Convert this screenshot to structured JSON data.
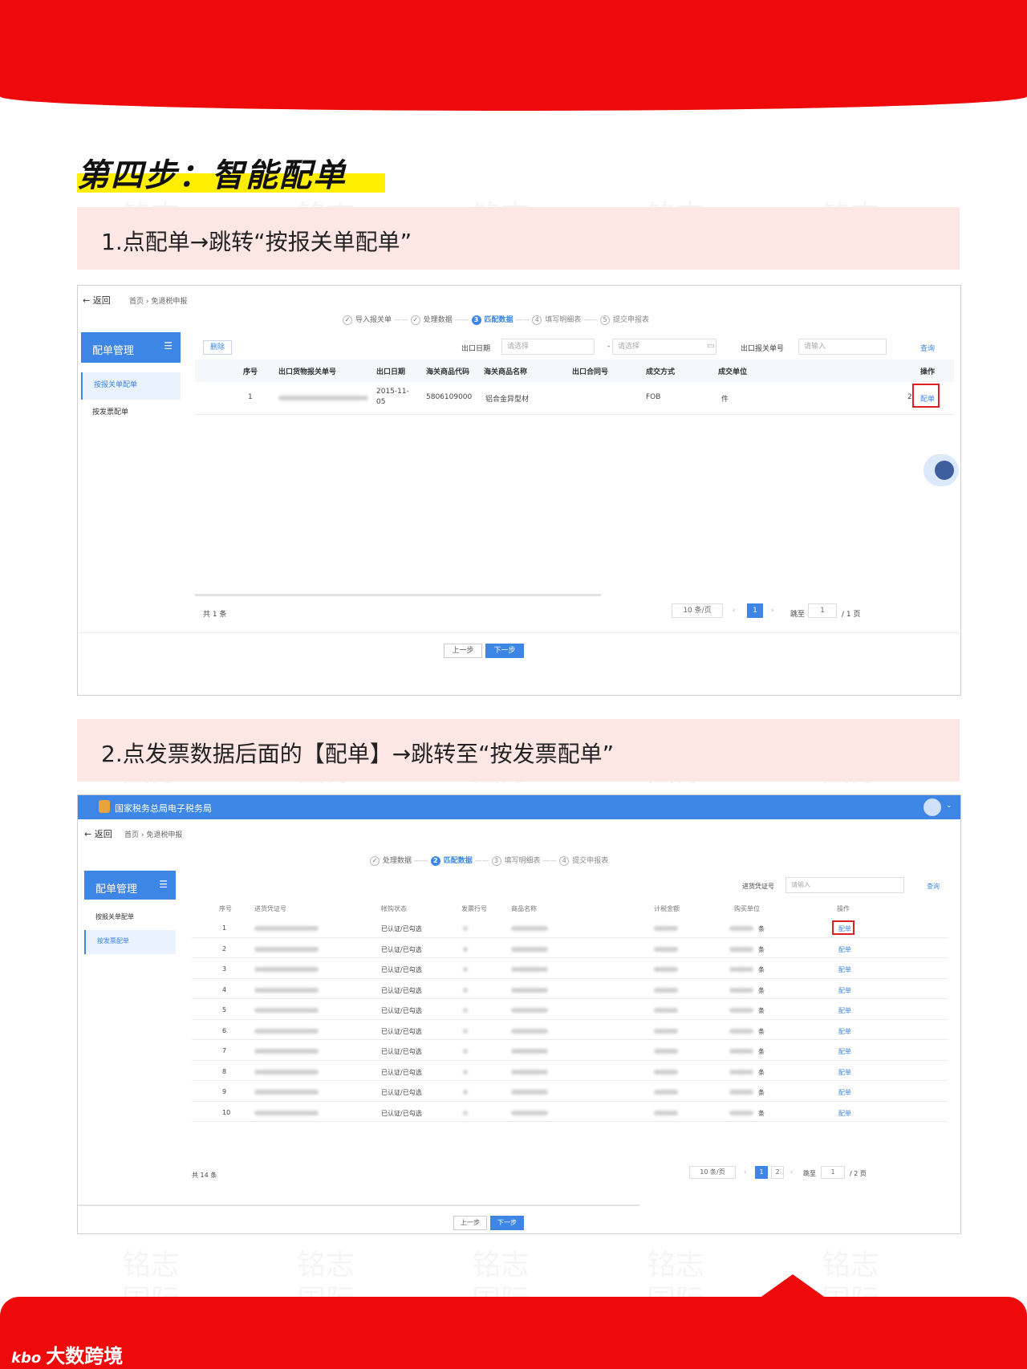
{
  "page": {
    "step_title": "第四步：智能配单",
    "instruction_1": "1.点配单→跳转“按报关单配单”",
    "instruction_2": "2.点发票数据后面的【配单】→跳转至“按发票配单”",
    "watermark_line1": "铭志",
    "watermark_line2": "国际",
    "brand": "大数跨境",
    "brand_logo": "kbo"
  },
  "colors": {
    "brand_red": "#ee0a0a",
    "accent_blue": "#3d86e6",
    "highlight_yellow": "#ffee00",
    "pink_bar": "#fde7e5",
    "annotation_red": "#e02020"
  },
  "screen1": {
    "back_label": "← 返回",
    "breadcrumb": "首页 › 免退税申报",
    "steps": [
      {
        "num": "✓",
        "label": "导入报关单",
        "state": "done"
      },
      {
        "num": "✓",
        "label": "处理数据",
        "state": "done"
      },
      {
        "num": "3",
        "label": "匹配数据",
        "state": "current"
      },
      {
        "num": "4",
        "label": "填写明细表",
        "state": "todo"
      },
      {
        "num": "5",
        "label": "提交申报表",
        "state": "todo"
      }
    ],
    "sidebar": {
      "title": "配单管理",
      "menu_icon": "☰",
      "items": [
        "按报关单配单",
        "按发票配单"
      ],
      "active_index": 0
    },
    "toolbar": {
      "delete_label": "删除",
      "date_label": "出口日期",
      "date_placeholder_start": "请选择",
      "date_separator": "-",
      "date_placeholder_end": "请选择",
      "calendar_icon": "calendar-icon",
      "declaration_label": "出口报关单号",
      "declaration_placeholder": "请输入",
      "query_label": "查询"
    },
    "columns": [
      "序号",
      "出口货物报关单号",
      "出口日期",
      "海关商品代码",
      "海关商品名称",
      "出口合同号",
      "成交方式",
      "成交单位",
      "操作"
    ],
    "rows": [
      {
        "no": "1",
        "date": "2015-11-05",
        "code": "5806109000",
        "name": "铝合金异型材",
        "contract": "",
        "deal": "FOB",
        "unit": "件",
        "action": "配单",
        "extra": "2"
      }
    ],
    "total": "共 1 条",
    "page_size": "10 条/页",
    "page_prev": "‹",
    "page_current": "1",
    "page_next": "›",
    "jump_label": "跳至",
    "jump_value": "1",
    "page_total": "/ 1 页",
    "prev_button": "上一步",
    "next_button": "下一步"
  },
  "screen2": {
    "app_title": "国家税务总局电子税务局",
    "back_label": "← 返回",
    "breadcrumb": "首页 › 免退税申报",
    "steps": [
      {
        "num": "✓",
        "label": "处理数据",
        "state": "done"
      },
      {
        "num": "2",
        "label": "匹配数据",
        "state": "current"
      },
      {
        "num": "3",
        "label": "填写明细表",
        "state": "todo"
      },
      {
        "num": "4",
        "label": "提交申报表",
        "state": "todo"
      }
    ],
    "sidebar": {
      "title": "配单管理",
      "menu_icon": "☰",
      "items": [
        "按报关单配单",
        "按发票配单"
      ],
      "active_index": 1
    },
    "toolbar": {
      "voucher_label": "进货凭证号",
      "voucher_placeholder": "请输入",
      "query_label": "查询"
    },
    "columns": [
      "序号",
      "进货凭证号",
      "帐钩状态",
      "发票行号",
      "商品名称",
      "计税金额",
      "购买单位",
      "操作"
    ],
    "rows": [
      {
        "no": "1",
        "status": "已认证/已勾选",
        "unit": "条",
        "action": "配单"
      },
      {
        "no": "2",
        "status": "已认证/已勾选",
        "unit": "条",
        "action": "配单"
      },
      {
        "no": "3",
        "status": "已认证/已勾选",
        "unit": "条",
        "action": "配单"
      },
      {
        "no": "4",
        "status": "已认证/已勾选",
        "unit": "条",
        "action": "配单"
      },
      {
        "no": "5",
        "status": "已认证/已勾选",
        "unit": "条",
        "action": "配单"
      },
      {
        "no": "6",
        "status": "已认证/已勾选",
        "unit": "条",
        "action": "配单"
      },
      {
        "no": "7",
        "status": "已认证/已勾选",
        "unit": "条",
        "action": "配单"
      },
      {
        "no": "8",
        "status": "已认证/已勾选",
        "unit": "条",
        "action": "配单"
      },
      {
        "no": "9",
        "status": "已认证/已勾选",
        "unit": "条",
        "action": "配单"
      },
      {
        "no": "10",
        "status": "已认证/已勾选",
        "unit": "条",
        "action": "配单"
      }
    ],
    "total": "共 14 条",
    "page_size": "10 条/页",
    "page_prev": "‹",
    "page_current": "1",
    "page_2": "2",
    "page_next": "›",
    "jump_label": "跳至",
    "jump_value": "1",
    "page_total": "/ 2 页",
    "prev_button": "上一步",
    "next_button": "下一步"
  }
}
